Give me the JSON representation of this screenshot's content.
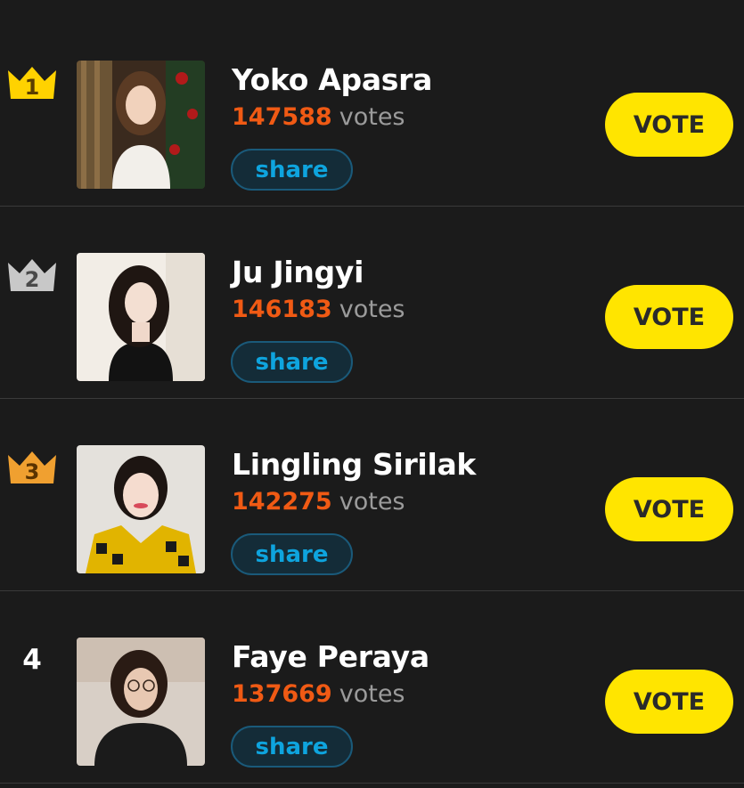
{
  "entries": [
    {
      "rank": "1",
      "name": "Yoko Apasra",
      "count": "147588",
      "votes_word": "votes",
      "share_label": "share",
      "vote_label": "VOTE",
      "crown_color": "#ffd200",
      "crown_text_color": "#5a3d00"
    },
    {
      "rank": "2",
      "name": "Ju Jingyi",
      "count": "146183",
      "votes_word": "votes",
      "share_label": "share",
      "vote_label": "VOTE",
      "crown_color": "#c8c8c8",
      "crown_text_color": "#4a4a4a"
    },
    {
      "rank": "3",
      "name": "Lingling Sirilak",
      "count": "142275",
      "votes_word": "votes",
      "share_label": "share",
      "vote_label": "VOTE",
      "crown_color": "#f0a030",
      "crown_text_color": "#5a3300"
    },
    {
      "rank": "4",
      "name": "Faye Peraya",
      "count": "137669",
      "votes_word": "votes",
      "share_label": "share",
      "vote_label": "VOTE"
    }
  ],
  "colors": {
    "background": "#1b1b1b",
    "vote_count": "#f05a14",
    "vote_button": "#ffe500",
    "share_text": "#0ea4de"
  },
  "icons": {
    "crown": "crown-icon"
  }
}
